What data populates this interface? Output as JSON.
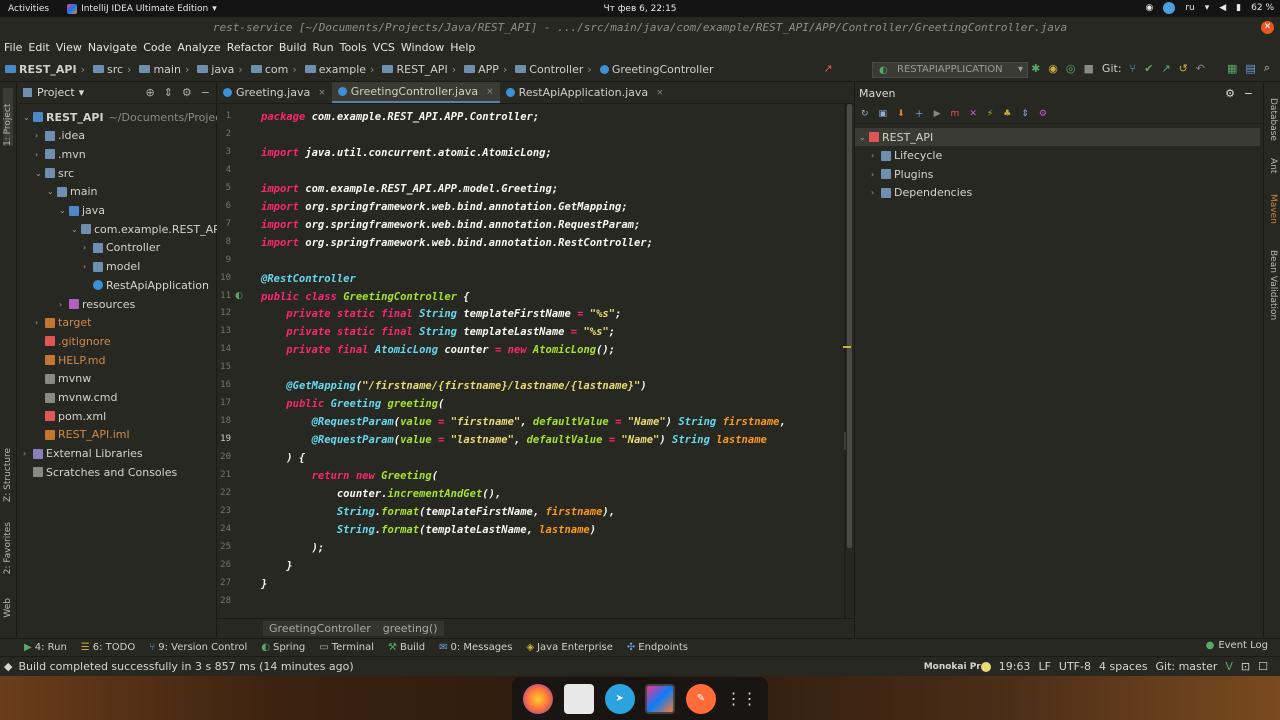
{
  "topbar": {
    "activities": "Activities",
    "app": "IntelliJ IDEA Ultimate Edition",
    "clock": "Чт фев  6, 22:15",
    "lang": "ru",
    "battery": "62 %"
  },
  "window": {
    "title": "rest-service [~/Documents/Projects/Java/REST_API] - .../src/main/java/com/example/REST_API/APP/Controller/GreetingController.java"
  },
  "menu": [
    "File",
    "Edit",
    "View",
    "Navigate",
    "Code",
    "Analyze",
    "Refactor",
    "Build",
    "Run",
    "Tools",
    "VCS",
    "Window",
    "Help"
  ],
  "breadcrumbs": [
    "REST_API",
    "src",
    "main",
    "java",
    "com",
    "example",
    "REST_API",
    "APP",
    "Controller",
    "GreetingController"
  ],
  "run_config": "RESTAPIAPPLICATION",
  "git_label": "Git:",
  "left_stripe": {
    "project": "1: Project",
    "structure": "Z: Structure",
    "favorites": "2: Favorites",
    "web": "Web"
  },
  "right_stripe": {
    "database": "Database",
    "ant": "Ant",
    "maven": "Maven",
    "bean": "Bean Validation"
  },
  "project": {
    "title": "Project",
    "tree": [
      {
        "label": "REST_API",
        "extra": "~/Documents/Projects/",
        "depth": 0,
        "arrow": "v",
        "kind": "root"
      },
      {
        "label": ".idea",
        "depth": 1,
        "arrow": ">",
        "kind": "folder"
      },
      {
        "label": ".mvn",
        "depth": 1,
        "arrow": ">",
        "kind": "folder"
      },
      {
        "label": "src",
        "depth": 1,
        "arrow": "v",
        "kind": "folder"
      },
      {
        "label": "main",
        "depth": 2,
        "arrow": "v",
        "kind": "folder"
      },
      {
        "label": "java",
        "depth": 3,
        "arrow": "v",
        "kind": "srcfolder"
      },
      {
        "label": "com.example.REST_API.A",
        "depth": 4,
        "arrow": "v",
        "kind": "package"
      },
      {
        "label": "Controller",
        "depth": 5,
        "arrow": ">",
        "kind": "package"
      },
      {
        "label": "model",
        "depth": 5,
        "arrow": ">",
        "kind": "package"
      },
      {
        "label": "RestApiApplication",
        "depth": 5,
        "arrow": "",
        "kind": "class"
      },
      {
        "label": "resources",
        "depth": 3,
        "arrow": ">",
        "kind": "resfolder"
      },
      {
        "label": "target",
        "depth": 1,
        "arrow": ">",
        "kind": "target"
      },
      {
        "label": ".gitignore",
        "depth": 1,
        "arrow": "",
        "kind": "git"
      },
      {
        "label": "HELP.md",
        "depth": 1,
        "arrow": "",
        "kind": "md"
      },
      {
        "label": "mvnw",
        "depth": 1,
        "arrow": "",
        "kind": "file"
      },
      {
        "label": "mvnw.cmd",
        "depth": 1,
        "arrow": "",
        "kind": "file"
      },
      {
        "label": "pom.xml",
        "depth": 1,
        "arrow": "",
        "kind": "maven"
      },
      {
        "label": "REST_API.iml",
        "depth": 1,
        "arrow": "",
        "kind": "iml"
      },
      {
        "label": "External Libraries",
        "depth": 0,
        "arrow": ">",
        "kind": "libs"
      },
      {
        "label": "Scratches and Consoles",
        "depth": 0,
        "arrow": "",
        "kind": "scratch"
      }
    ]
  },
  "tabs": [
    {
      "label": "Greeting.java",
      "active": false
    },
    {
      "label": "GreetingController.java",
      "active": true
    },
    {
      "label": "RestApiApplication.java",
      "active": false
    }
  ],
  "code": [
    {
      "n": "1",
      "t": [
        [
          "k",
          "package "
        ],
        [
          "n",
          "com.example.REST_API.APP.Controller"
        ],
        [
          "n",
          ";"
        ]
      ]
    },
    {
      "n": "2",
      "t": []
    },
    {
      "n": "3",
      "t": [
        [
          "k",
          "import "
        ],
        [
          "n",
          "java.util.concurrent.atomic.AtomicLong"
        ],
        [
          "n",
          ";"
        ]
      ]
    },
    {
      "n": "4",
      "t": []
    },
    {
      "n": "5",
      "t": [
        [
          "k",
          "import "
        ],
        [
          "n",
          "com.example.REST_API.APP.model.Greeting"
        ],
        [
          "n",
          ";"
        ]
      ]
    },
    {
      "n": "6",
      "t": [
        [
          "k",
          "import "
        ],
        [
          "n",
          "org.springframework.web.bind.annotation.GetMapping"
        ],
        [
          "n",
          ";"
        ]
      ]
    },
    {
      "n": "7",
      "t": [
        [
          "k",
          "import "
        ],
        [
          "n",
          "org.springframework.web.bind.annotation.RequestParam"
        ],
        [
          "n",
          ";"
        ]
      ]
    },
    {
      "n": "8",
      "t": [
        [
          "k",
          "import "
        ],
        [
          "n",
          "org.springframework.web.bind.annotation.RestController"
        ],
        [
          "n",
          ";"
        ]
      ]
    },
    {
      "n": "9",
      "t": []
    },
    {
      "n": "10",
      "t": [
        [
          "kb",
          "@RestController"
        ]
      ]
    },
    {
      "n": "11",
      "t": [
        [
          "k",
          "public class "
        ],
        [
          "t",
          "GreetingController "
        ],
        [
          "n",
          "{"
        ]
      ]
    },
    {
      "n": "12",
      "t": [
        [
          "n",
          "    "
        ],
        [
          "k",
          "private static final "
        ],
        [
          "kb",
          "String "
        ],
        [
          "n",
          "templateFirstName "
        ],
        [
          "k",
          "= "
        ],
        [
          "s",
          "\"%s\""
        ],
        [
          "n",
          ";"
        ]
      ]
    },
    {
      "n": "13",
      "t": [
        [
          "n",
          "    "
        ],
        [
          "k",
          "private static final "
        ],
        [
          "kb",
          "String "
        ],
        [
          "n",
          "templateLastName "
        ],
        [
          "k",
          "= "
        ],
        [
          "s",
          "\"%s\""
        ],
        [
          "n",
          ";"
        ]
      ]
    },
    {
      "n": "14",
      "t": [
        [
          "n",
          "    "
        ],
        [
          "k",
          "private final "
        ],
        [
          "kb",
          "AtomicLong "
        ],
        [
          "n",
          "counter "
        ],
        [
          "k",
          "= new "
        ],
        [
          "t",
          "AtomicLong"
        ],
        [
          "n",
          "();"
        ]
      ]
    },
    {
      "n": "15",
      "t": []
    },
    {
      "n": "16",
      "t": [
        [
          "n",
          "    "
        ],
        [
          "kb",
          "@GetMapping"
        ],
        [
          "n",
          "("
        ],
        [
          "s",
          "\"/firstname/{firstname}/lastname/{lastname}\""
        ],
        [
          "n",
          ")"
        ]
      ]
    },
    {
      "n": "17",
      "t": [
        [
          "n",
          "    "
        ],
        [
          "k",
          "public "
        ],
        [
          "kb",
          "Greeting "
        ],
        [
          "t",
          "greeting"
        ],
        [
          "n",
          "("
        ]
      ]
    },
    {
      "n": "18",
      "t": [
        [
          "n",
          "        "
        ],
        [
          "kb",
          "@RequestParam"
        ],
        [
          "n",
          "("
        ],
        [
          "t",
          "value "
        ],
        [
          "k",
          "= "
        ],
        [
          "s",
          "\"firstname\""
        ],
        [
          "n",
          ", "
        ],
        [
          "t",
          "defaultValue "
        ],
        [
          "k",
          "= "
        ],
        [
          "s",
          "\"Name\""
        ],
        [
          "n",
          ") "
        ],
        [
          "kb",
          "String "
        ],
        [
          "pa",
          "firstname"
        ],
        [
          "n",
          ","
        ]
      ]
    },
    {
      "n": "19",
      "t": [
        [
          "n",
          "        "
        ],
        [
          "kb",
          "@RequestParam"
        ],
        [
          "n",
          "("
        ],
        [
          "t",
          "value "
        ],
        [
          "k",
          "= "
        ],
        [
          "s",
          "\"lastname\""
        ],
        [
          "n",
          ", "
        ],
        [
          "t",
          "defaultValue "
        ],
        [
          "k",
          "= "
        ],
        [
          "s",
          "\"Name\""
        ],
        [
          "n",
          ") "
        ],
        [
          "kb",
          "String "
        ],
        [
          "pa",
          "lastname"
        ]
      ]
    },
    {
      "n": "20",
      "t": [
        [
          "n",
          "    ) {"
        ]
      ]
    },
    {
      "n": "21",
      "t": [
        [
          "n",
          "        "
        ],
        [
          "k",
          "return new "
        ],
        [
          "t",
          "Greeting"
        ],
        [
          "n",
          "("
        ]
      ]
    },
    {
      "n": "22",
      "t": [
        [
          "n",
          "            counter."
        ],
        [
          "t",
          "incrementAndGet"
        ],
        [
          "n",
          "(),"
        ]
      ]
    },
    {
      "n": "23",
      "t": [
        [
          "n",
          "            "
        ],
        [
          "kb",
          "String"
        ],
        [
          "n",
          "."
        ],
        [
          "fn",
          "format"
        ],
        [
          "n",
          "(templateFirstName, "
        ],
        [
          "pa",
          "firstname"
        ],
        [
          "n",
          "),"
        ]
      ]
    },
    {
      "n": "24",
      "t": [
        [
          "n",
          "            "
        ],
        [
          "kb",
          "String"
        ],
        [
          "n",
          "."
        ],
        [
          "fn",
          "format"
        ],
        [
          "n",
          "(templateLastName, "
        ],
        [
          "pa",
          "lastname"
        ],
        [
          "n",
          ")"
        ]
      ]
    },
    {
      "n": "25",
      "t": [
        [
          "n",
          "        );"
        ]
      ]
    },
    {
      "n": "26",
      "t": [
        [
          "n",
          "    }"
        ]
      ]
    },
    {
      "n": "27",
      "t": [
        [
          "n",
          "}"
        ]
      ]
    },
    {
      "n": "28",
      "t": []
    }
  ],
  "editor_breadcrumb": [
    "GreetingController",
    "greeting()"
  ],
  "maven": {
    "title": "Maven",
    "tree": [
      {
        "label": "REST_API",
        "arrow": "v",
        "depth": 0
      },
      {
        "label": "Lifecycle",
        "arrow": ">",
        "depth": 1
      },
      {
        "label": "Plugins",
        "arrow": ">",
        "depth": 1
      },
      {
        "label": "Dependencies",
        "arrow": ">",
        "depth": 1
      }
    ]
  },
  "bottom_tools": [
    "4: Run",
    "6: TODO",
    "9: Version Control",
    "Spring",
    "Terminal",
    "Build",
    "0: Messages",
    "Java Enterprise",
    "Endpoints"
  ],
  "event_log": "Event Log",
  "status": {
    "message": "Build completed successfully in 3 s 857 ms (14 minutes ago)",
    "theme": "Monokai Pr",
    "position": "19:63",
    "line_sep": "LF",
    "encoding": "UTF-8",
    "indent": "4 spaces",
    "git": "Git: master"
  },
  "colors": {
    "editor_bg": "#272822",
    "keyword": "#f92672",
    "type": "#66d9ef",
    "string": "#e6db74",
    "function": "#a6e22e",
    "param": "#fd971f"
  }
}
